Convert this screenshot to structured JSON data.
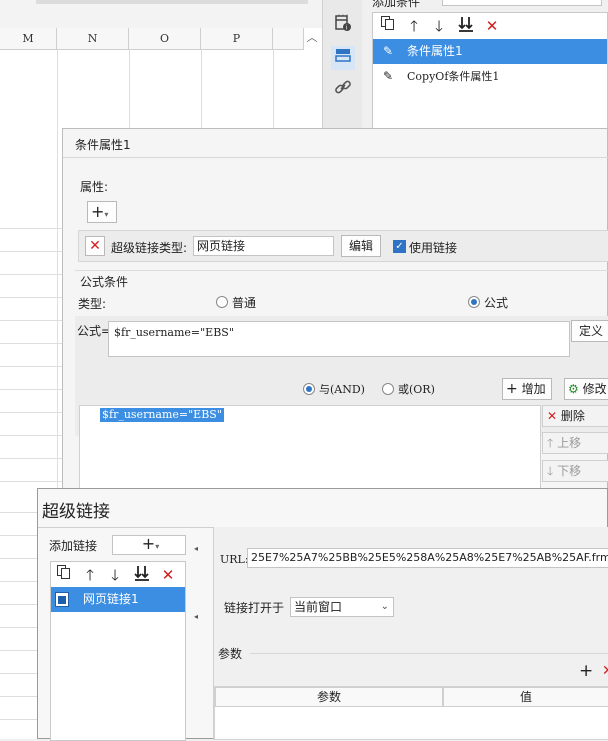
{
  "sheet": {
    "columns": [
      "M",
      "N",
      "O",
      "P"
    ]
  },
  "cond_panel": {
    "add_condition_label": "添加条件",
    "items": [
      {
        "label": "条件属性1",
        "selected": true
      },
      {
        "label": "CopyOf条件属性1",
        "selected": false
      }
    ]
  },
  "attr_dialog": {
    "title": "条件属性1",
    "attributes_label": "属性:",
    "add_symbol": "+",
    "hyperlink_type_label": "超级链接类型:",
    "hyperlink_type_value": "网页链接",
    "edit_button": "编辑",
    "use_link_label": "使用链接",
    "use_link_checked": true,
    "formula_section_label": "公式条件",
    "type_label": "类型:",
    "type_options": [
      "普通",
      "公式"
    ],
    "type_selected": "公式",
    "formula_label": "公式=",
    "formula_value": "$fr_username=\"EBS\"",
    "define_button": "定义",
    "logic_and": "与(AND)",
    "logic_or": "或(OR)",
    "logic_selected": "与(AND)",
    "add_button": "增加",
    "modify_button": "修改",
    "condition_list": [
      "$fr_username=\"EBS\""
    ],
    "delete_button": "删除",
    "move_up_button": "上移",
    "move_down_button": "下移"
  },
  "link_dialog": {
    "title": "超级链接",
    "add_link_label": "添加链接",
    "add_symbol": "+",
    "links": [
      {
        "label": "网页链接1",
        "selected": true
      }
    ],
    "url_label": "URL:",
    "url_value": "25E7%25A7%25BB%25E5%258A%25A8%25E7%25AB%25AF.frm",
    "open_in_label": "链接打开于",
    "open_in_value": "当前窗口",
    "params_label": "参数",
    "params_columns": [
      "参数",
      "值"
    ],
    "params_add_symbol": "+"
  },
  "colors": {
    "selection": "#3c8ee2",
    "delete_red": "#d32020",
    "accent_blue": "#2f74c4"
  }
}
